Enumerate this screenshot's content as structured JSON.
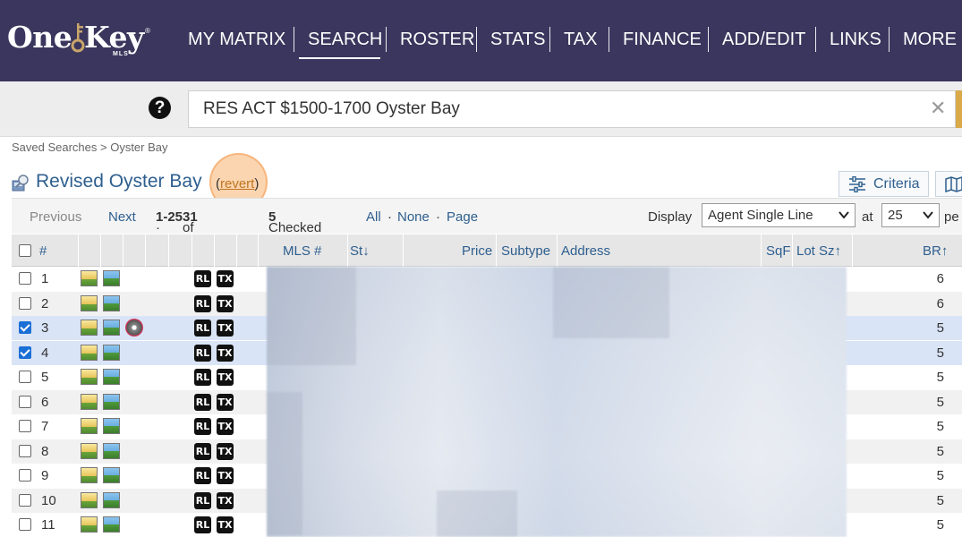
{
  "logo": {
    "word_one": "One",
    "word_key": "Key",
    "registered": "®",
    "sub": "MLS"
  },
  "nav": {
    "items": [
      {
        "label": "MY MATRIX"
      },
      {
        "label": "SEARCH"
      },
      {
        "label": "ROSTER"
      },
      {
        "label": "STATS"
      },
      {
        "label": "TAX"
      },
      {
        "label": "FINANCE"
      },
      {
        "label": "ADD/EDIT"
      },
      {
        "label": "LINKS"
      },
      {
        "label": "MORE"
      }
    ],
    "active": "SEARCH"
  },
  "search": {
    "help_glyph": "?",
    "value": "RES ACT $1500-1700 Oyster Bay",
    "clear_glyph": "✕"
  },
  "breadcrumb": "Saved Searches > Oyster Bay",
  "title": {
    "text": "Revised Oyster Bay",
    "revert_open": "(",
    "revert_label": "revert",
    "revert_close": ")"
  },
  "toolbar": {
    "criteria_label": "Criteria"
  },
  "pager": {
    "previous": "Previous",
    "next": "Next",
    "range_prefix": "· ",
    "range": "1-25",
    "of": " of ",
    "total": "31",
    "checked_label": "Checked",
    "checked_count": "5",
    "all": "All",
    "none": "None",
    "page": "Page",
    "dot": " · ",
    "display_label": "Display",
    "display_value": "Agent Single Line",
    "at_label": "at",
    "per_page_value": "25",
    "per_label": "pe"
  },
  "table": {
    "columns": {
      "num": "#",
      "mls": "MLS #",
      "status": "St",
      "price": "Price",
      "subtype": "Subtype",
      "address": "Address",
      "sqf": "SqF",
      "lotsz": "Lot Sz",
      "br": "BR"
    },
    "sort_down_glyph": "↓",
    "sort_up_glyph": "↑",
    "tag_rl": "RL",
    "tag_tx": "TX",
    "rows": [
      {
        "num": "1",
        "br": "6",
        "checked": false,
        "film": false
      },
      {
        "num": "2",
        "br": "6",
        "checked": false,
        "film": false
      },
      {
        "num": "3",
        "br": "5",
        "checked": true,
        "film": true
      },
      {
        "num": "4",
        "br": "5",
        "checked": true,
        "film": false
      },
      {
        "num": "5",
        "br": "5",
        "checked": false,
        "film": false
      },
      {
        "num": "6",
        "br": "5",
        "checked": false,
        "film": false
      },
      {
        "num": "7",
        "br": "5",
        "checked": false,
        "film": false
      },
      {
        "num": "8",
        "br": "5",
        "checked": false,
        "film": false
      },
      {
        "num": "9",
        "br": "5",
        "checked": false,
        "film": false
      },
      {
        "num": "10",
        "br": "5",
        "checked": false,
        "film": false
      },
      {
        "num": "11",
        "br": "5",
        "checked": false,
        "film": false
      }
    ]
  },
  "colors": {
    "nav_bg": "#3a365d",
    "link": "#2e5f8f",
    "checked_row": "#d9e4f7",
    "revert": "#c07520",
    "highlight": "#f8b270"
  }
}
